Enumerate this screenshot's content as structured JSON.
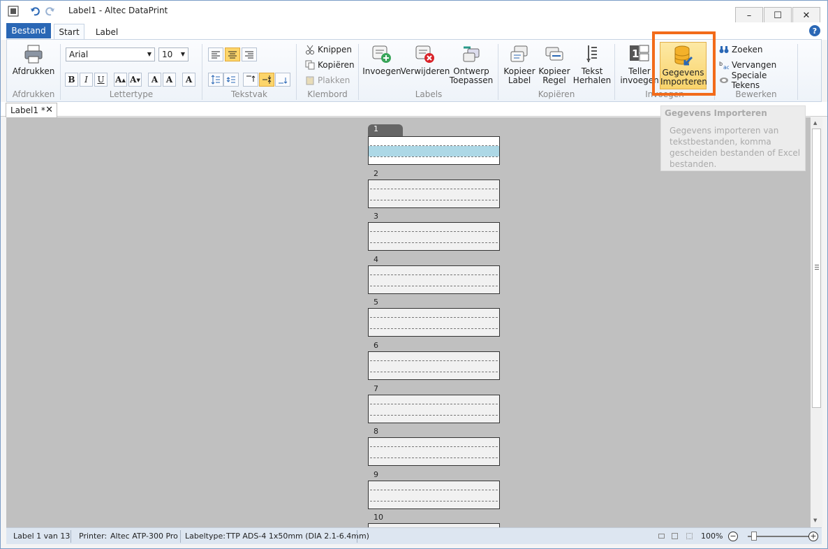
{
  "window": {
    "title": "Label1 - Altec DataPrint",
    "minimize": "–",
    "maximize": "☐",
    "close": "✕"
  },
  "ribbon_tabs": {
    "bestand": "Bestand",
    "start": "Start",
    "label": "Label",
    "help": "?"
  },
  "groups": {
    "afdrukken": {
      "label": "Afdrukken",
      "print": "Afdrukken"
    },
    "lettertype": {
      "label": "Lettertype",
      "font": "Arial",
      "size": "10"
    },
    "tekstvak": {
      "label": "Tekstvak"
    },
    "klembord": {
      "label": "Klembord",
      "cut": "Knippen",
      "copy": "Kopiëren",
      "paste": "Plakken"
    },
    "labels": {
      "label": "Labels",
      "insert": "Invoegen",
      "delete": "Verwijderen",
      "design1": "Ontwerp",
      "design2": "Toepassen"
    },
    "kopieren": {
      "label": "Kopiëren",
      "copylabel1": "Kopieer",
      "copylabel2": "Label",
      "copyrow1": "Kopieer",
      "copyrow2": "Regel",
      "repeat1": "Tekst",
      "repeat2": "Herhalen"
    },
    "invoegen": {
      "label": "Invoegen",
      "counter1": "Teller",
      "counter2": "invoegen",
      "import1": "Gegevens",
      "import2": "Importeren"
    },
    "bewerken": {
      "label": "Bewerken",
      "find": "Zoeken",
      "replace": "Vervangen",
      "special": "Speciale Tekens"
    }
  },
  "tooltip": {
    "title": "Gegevens Importeren",
    "body": "Gegevens importeren van tekstbestanden, komma gescheiden bestanden of Excel bestanden."
  },
  "doctab": {
    "name": "Label1 *",
    "close": "✕"
  },
  "labels": [
    "1",
    "2",
    "3",
    "4",
    "5",
    "6",
    "7",
    "8",
    "9",
    "10"
  ],
  "status": {
    "label_count": "Label 1 van 13",
    "printer_label": "Printer:",
    "printer": "Altec ATP-300 Pro",
    "labeltype_label": "Labeltype:",
    "labeltype": "TTP ADS-4 1x50mm (DIA 2.1-6.4mm)",
    "zoom": "100%",
    "zoom_minus": "−",
    "zoom_plus": "+"
  },
  "colors": {
    "accent": "#2a67b5",
    "highlight": "#f26b1a",
    "selected_row": "#add8e6",
    "canvas": "#c0c0c0"
  }
}
